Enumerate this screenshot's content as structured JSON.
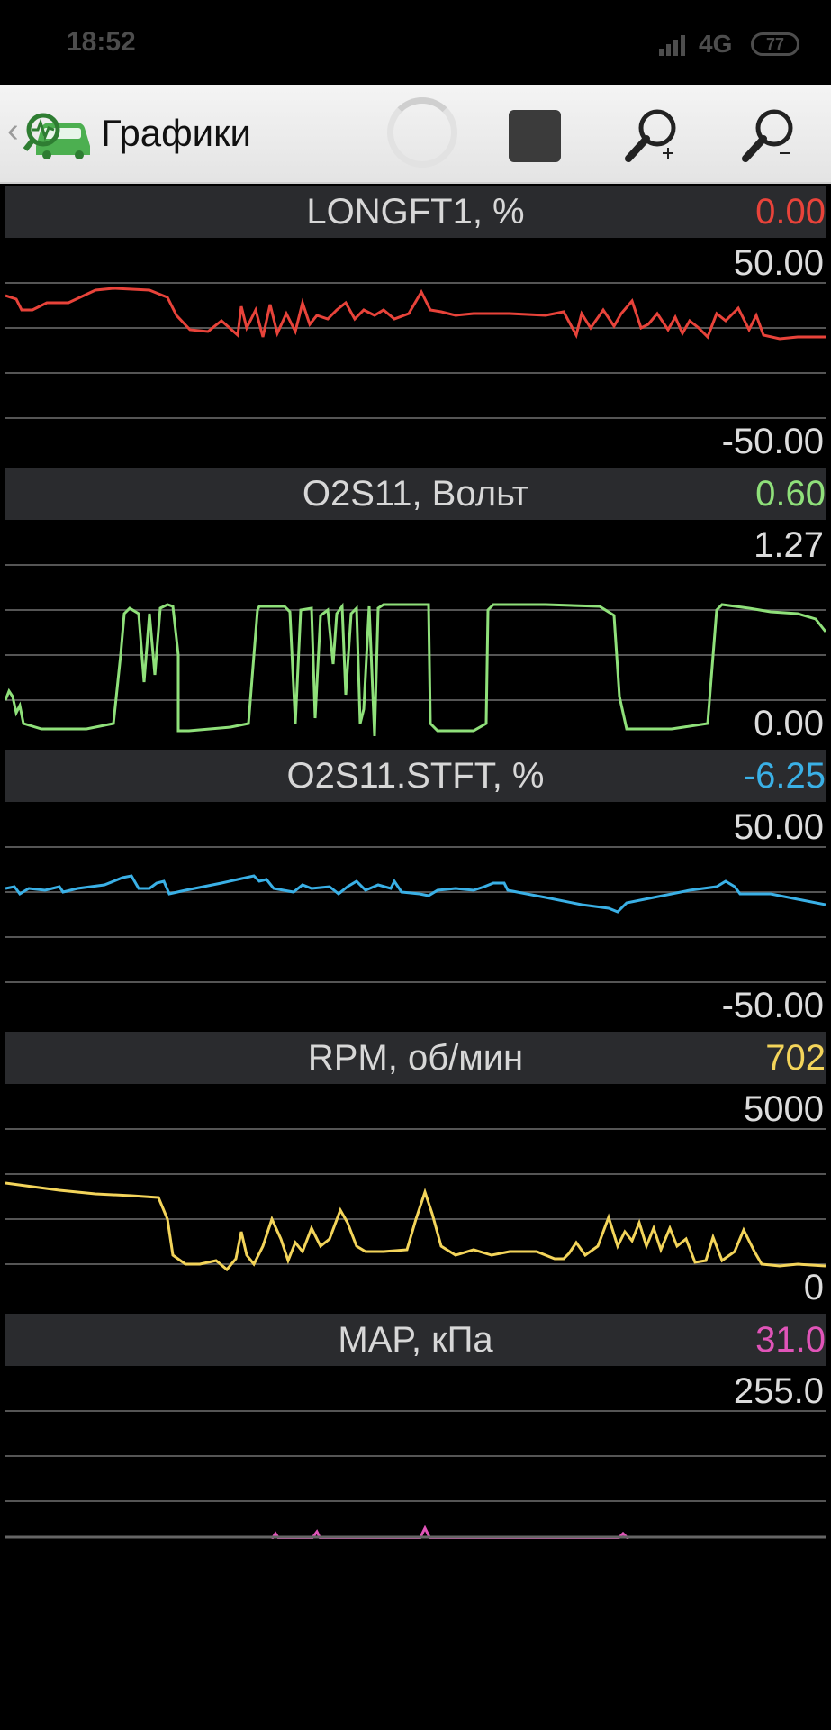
{
  "status_bar": {
    "time": "18:52",
    "network": "4G",
    "battery": "77"
  },
  "toolbar": {
    "title": "Графики"
  },
  "colors": {
    "longft": "#e8433a",
    "o2": "#8fe07a",
    "stft": "#3ab0e6",
    "rpm": "#f3d45a",
    "map": "#e054b8"
  },
  "charts": [
    {
      "name": "LONGFT1, %",
      "current": "0.00",
      "max": "50.00",
      "min": "-50.00"
    },
    {
      "name": "O2S11, Вольт",
      "current": "0.60",
      "max": "1.27",
      "min": "0.00"
    },
    {
      "name": "O2S11.STFT, %",
      "current": "-6.25",
      "max": "50.00",
      "min": "-50.00"
    },
    {
      "name": "RPM, об/мин",
      "current": "702",
      "max": "5000",
      "min": "0"
    },
    {
      "name": "MAP, кПа",
      "current": "31.0",
      "max": "255.0"
    }
  ]
}
